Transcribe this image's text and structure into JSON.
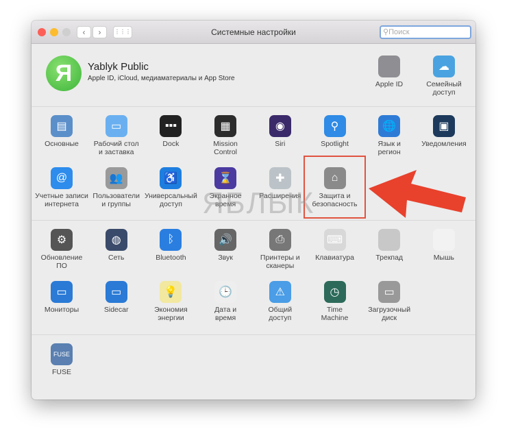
{
  "window": {
    "title": "Системные настройки",
    "search_placeholder": "Поиск",
    "back": "‹",
    "forward": "›",
    "grid": "⋮⋮⋮"
  },
  "account": {
    "avatar_letter": "Я",
    "name": "Yablyk Public",
    "subtitle": "Apple ID, iCloud, медиаматериалы и App Store",
    "items": [
      {
        "label": "Apple ID",
        "icon": "apple-icon",
        "color": "#8e8e93",
        "glyph": ""
      },
      {
        "label": "Семейный\nдоступ",
        "icon": "family-cloud-icon",
        "color": "#4aa3e0",
        "glyph": "☁"
      }
    ]
  },
  "sections": [
    [
      {
        "label": "Основные",
        "icon": "general-icon",
        "color": "#5b8fc9",
        "glyph": "▤"
      },
      {
        "label": "Рабочий стол\nи заставка",
        "icon": "desktop-icon",
        "color": "#6ab0f0",
        "glyph": "▭"
      },
      {
        "label": "Dock",
        "icon": "dock-icon",
        "color": "#222",
        "glyph": "▪▪▪"
      },
      {
        "label": "Mission\nControl",
        "icon": "mission-control-icon",
        "color": "#2c2c2c",
        "glyph": "▦"
      },
      {
        "label": "Siri",
        "icon": "siri-icon",
        "color": "#3a2a6a",
        "glyph": "◉"
      },
      {
        "label": "Spotlight",
        "icon": "spotlight-icon",
        "color": "#2f8be6",
        "glyph": "⚲"
      },
      {
        "label": "Язык и\nрегион",
        "icon": "language-region-icon",
        "color": "#2e7bd6",
        "glyph": "🌐"
      },
      {
        "label": "Уведомления",
        "icon": "notifications-icon",
        "color": "#1d3a5c",
        "glyph": "▣"
      },
      {
        "label": "Учетные записи\nинтернета",
        "icon": "internet-accounts-icon",
        "color": "#2d8cec",
        "glyph": "@"
      },
      {
        "label": "Пользователи\nи группы",
        "icon": "users-groups-icon",
        "color": "#9a9a9a",
        "glyph": "👥"
      },
      {
        "label": "Универсальный\nдоступ",
        "icon": "accessibility-icon",
        "color": "#1e7ee0",
        "glyph": "♿"
      },
      {
        "label": "Экранное\nвремя",
        "icon": "screen-time-icon",
        "color": "#4b3aa0",
        "glyph": "⌛"
      },
      {
        "label": "Расширения",
        "icon": "extensions-icon",
        "color": "#bcc3c8",
        "glyph": "✚"
      },
      {
        "label": "Защита и\nбезопасность",
        "icon": "security-icon",
        "color": "#8a8a8a",
        "glyph": "⌂"
      }
    ],
    [
      {
        "label": "Обновление\nПО",
        "icon": "software-update-icon",
        "color": "#555",
        "glyph": "⚙"
      },
      {
        "label": "Сеть",
        "icon": "network-icon",
        "color": "#3a4a6a",
        "glyph": "◍"
      },
      {
        "label": "Bluetooth",
        "icon": "bluetooth-icon",
        "color": "#2a7ee0",
        "glyph": "ᛒ"
      },
      {
        "label": "Звук",
        "icon": "sound-icon",
        "color": "#666",
        "glyph": "🔊"
      },
      {
        "label": "Принтеры и\nсканеры",
        "icon": "printers-icon",
        "color": "#777",
        "glyph": "⎙"
      },
      {
        "label": "Клавиатура",
        "icon": "keyboard-icon",
        "color": "#d8d8d8",
        "glyph": "⌨"
      },
      {
        "label": "Трекпад",
        "icon": "trackpad-icon",
        "color": "#c8c8c8",
        "glyph": ""
      },
      {
        "label": "Мышь",
        "icon": "mouse-icon",
        "color": "#f2f2f2",
        "glyph": ""
      },
      {
        "label": "Мониторы",
        "icon": "displays-icon",
        "color": "#2a7ad6",
        "glyph": "▭"
      },
      {
        "label": "Sidecar",
        "icon": "sidecar-icon",
        "color": "#2a7ad6",
        "glyph": "▭"
      },
      {
        "label": "Экономия\nэнергии",
        "icon": "energy-saver-icon",
        "color": "#f2e8a0",
        "glyph": "💡"
      },
      {
        "label": "Дата и\nвремя",
        "icon": "date-time-icon",
        "color": "#eee",
        "glyph": "🕒"
      },
      {
        "label": "Общий\nдоступ",
        "icon": "sharing-icon",
        "color": "#4a9de6",
        "glyph": "⚠"
      },
      {
        "label": "Time\nMachine",
        "icon": "time-machine-icon",
        "color": "#2d6a5a",
        "glyph": "◷"
      },
      {
        "label": "Загрузочный\nдиск",
        "icon": "startup-disk-icon",
        "color": "#999",
        "glyph": "▭"
      }
    ],
    [
      {
        "label": "FUSE",
        "icon": "fuse-icon",
        "color": "#5a7fb0",
        "glyph": "FUSE"
      }
    ]
  ],
  "watermark": "ЯБЛЫК",
  "highlight_color": "#e0533f"
}
